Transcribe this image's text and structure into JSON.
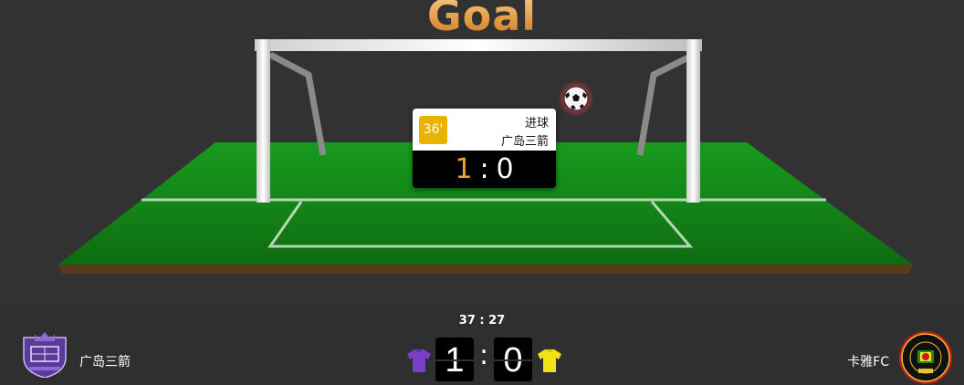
{
  "stage": {
    "title": "Goal",
    "event": {
      "minute": "36'",
      "type": "进球",
      "team": "广岛三箭",
      "home_score": "1",
      "separator": ":",
      "away_score": "0"
    }
  },
  "scoreboard": {
    "clock": "37 : 27",
    "home_team": "广岛三箭",
    "away_team": "卡雅FC",
    "home_score": "1",
    "away_score": "0",
    "separator": ":"
  },
  "colors": {
    "background": "#2f2f2f",
    "pitch": "#1f8a1f",
    "minute_badge": "#e8b400",
    "home_score_highlight": "#f0a330",
    "home_shirt": "#7a3fc8",
    "away_shirt": "#f2e21a"
  },
  "icons": {
    "ball": "soccer-ball-icon",
    "home_shirt": "purple-jersey-icon",
    "away_shirt": "yellow-jersey-icon",
    "home_logo": "home-team-crest",
    "away_logo": "away-team-crest"
  }
}
